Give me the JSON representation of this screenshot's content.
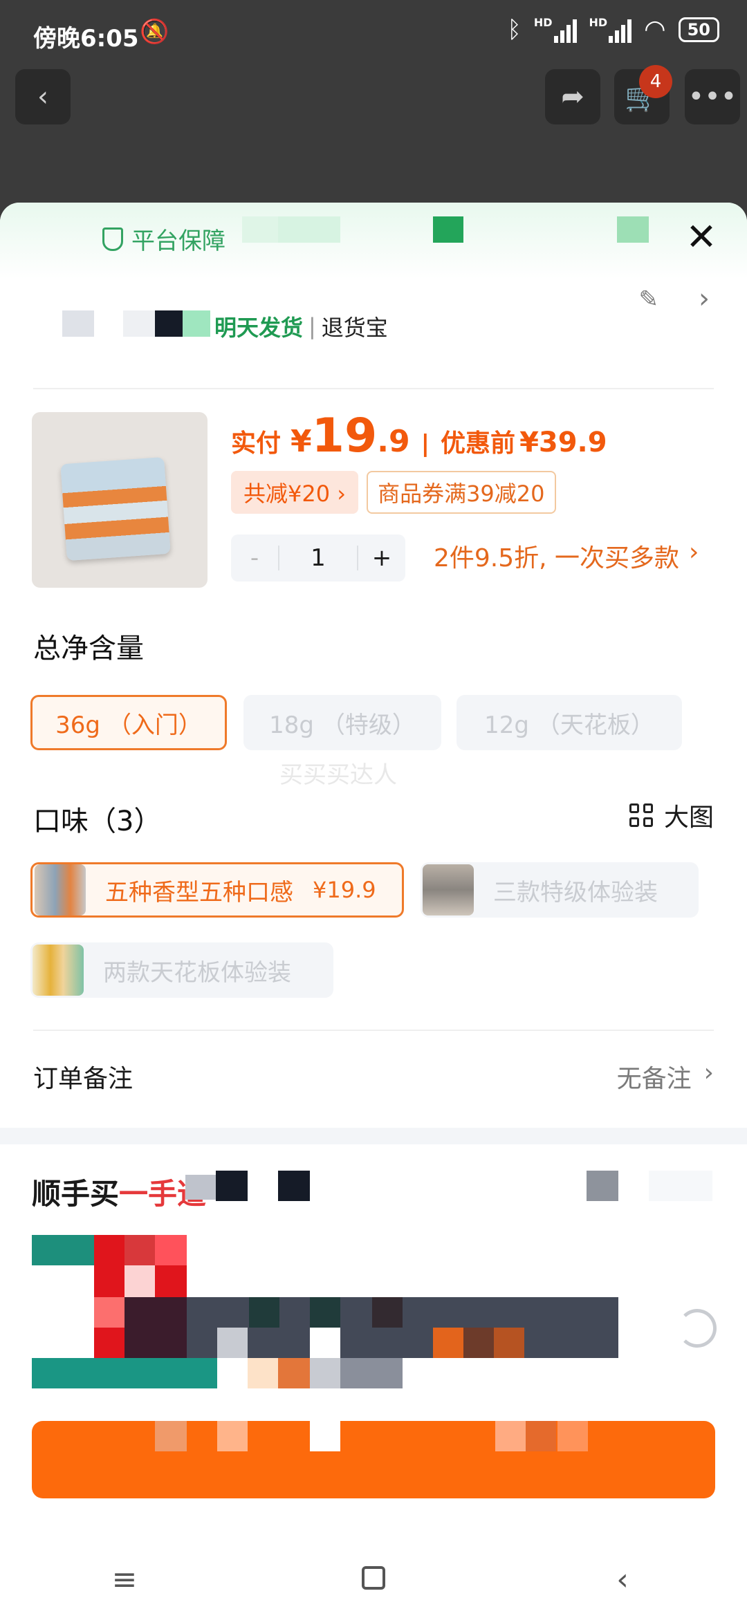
{
  "status": {
    "time": "傍晚6:05",
    "battery": "50",
    "signal1_label": "HD",
    "signal2_label": "HD"
  },
  "nav": {
    "cart_count": "4"
  },
  "sheet": {
    "guarantee": "平台保障",
    "shipping": {
      "green_text": "明天发货",
      "return_text": "退货宝"
    },
    "price": {
      "label": "实付",
      "currency": "¥",
      "int": "19",
      "dec": ".9",
      "sep": "|",
      "orig_label": "优惠前",
      "orig_price": "¥39.9"
    },
    "tags": {
      "discount": "共减¥20 ›",
      "coupon": "商品券满39减20"
    },
    "quantity": {
      "minus": "-",
      "value": "1",
      "plus": "+"
    },
    "promo": {
      "text": "2件9.5折, 一次买多款",
      "chevron": "›"
    },
    "net_content": {
      "title": "总净含量",
      "options": [
        "36g （入门）",
        "18g （特级）",
        "12g （天花板）"
      ],
      "selected_index": 0
    },
    "watermark": "买买买达人",
    "flavor": {
      "title": "口味（3）",
      "big_view": "大图",
      "options": [
        {
          "label": "五种香型五种口感",
          "price": "¥19.9"
        },
        {
          "label": "三款特级体验装"
        },
        {
          "label": "两款天花板体验装"
        }
      ],
      "selected_index": 0
    },
    "note": {
      "label": "订单备注",
      "value": "无备注",
      "chevron": "›"
    },
    "buy_together": {
      "title_black": "顺手买",
      "title_red": "一手道"
    }
  },
  "colors": {
    "accent": "#f2590c",
    "green": "#1f9a52",
    "cta": "#fd6a0c"
  },
  "system_nav": {
    "menu": "≡",
    "back": "‹"
  }
}
